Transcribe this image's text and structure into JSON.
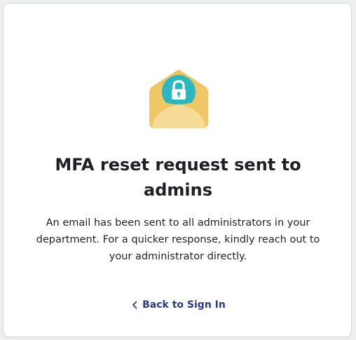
{
  "page": {
    "title": "MFA reset request sent to admins",
    "message": "An email has been sent to all administrators in your department. For a quicker response, kindly reach out to your administrator directly.",
    "back_link_label": "Back to Sign In"
  },
  "icons": {
    "illustration": "envelope-lock-icon",
    "back": "chevron-left-icon"
  },
  "colors": {
    "envelope_body": "#f0c766",
    "envelope_flap": "#f7dc98",
    "lock_circle": "#2bb7bf",
    "link": "#2b3a8f",
    "text": "#1e2025"
  }
}
